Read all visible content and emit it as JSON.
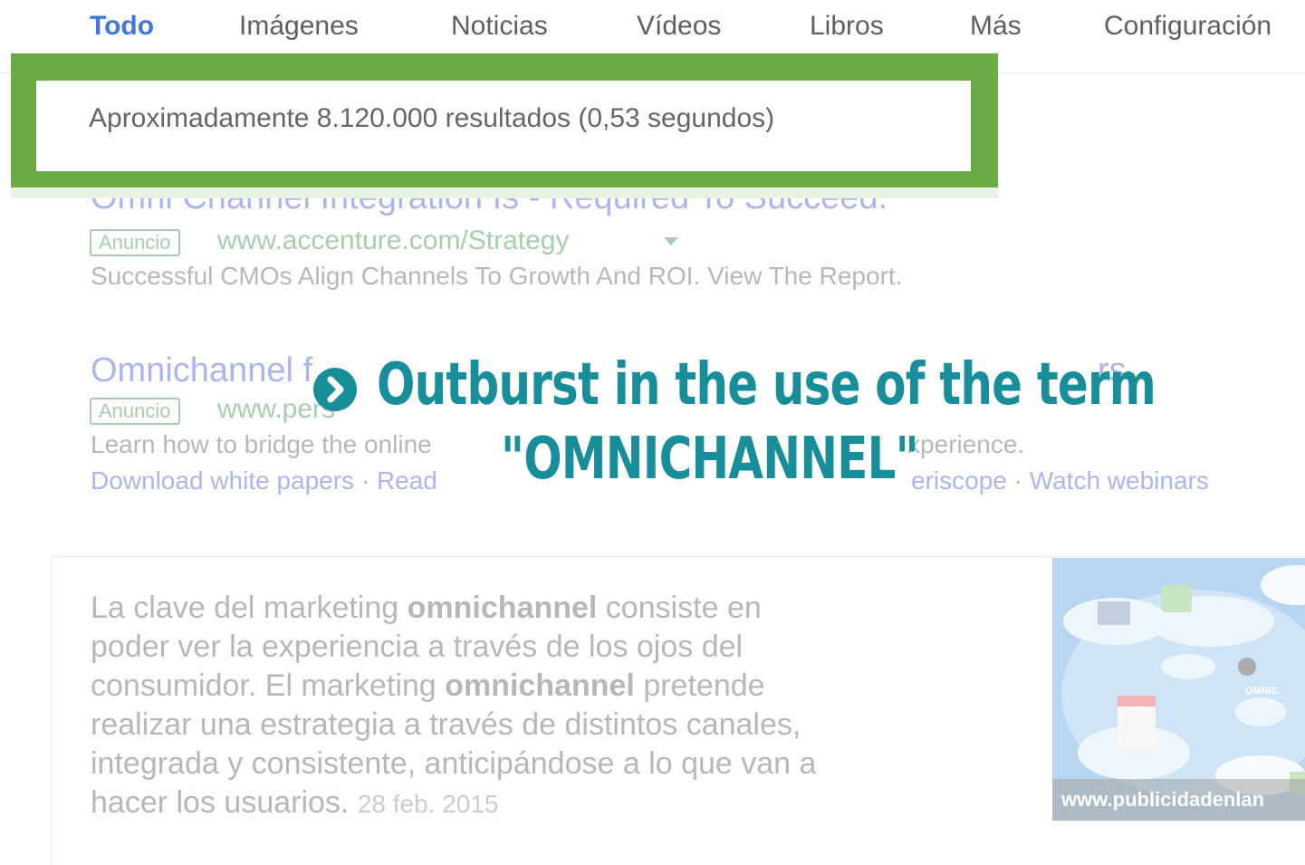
{
  "tabs": [
    "Todo",
    "Imágenes",
    "Noticias",
    "Vídeos",
    "Libros",
    "Más",
    "Configuración"
  ],
  "active_tab": "Todo",
  "result_stats": "Aproximadamente 8.120.000 resultados (0,53 segundos)",
  "ads": [
    {
      "title": "Omni Channel Integration Is - Required To Succeed.",
      "badge": "Anuncio",
      "url": "www.accenture.com/Strategy",
      "description": "Successful CMOs Align Channels To Growth And ROI. View The Report."
    },
    {
      "title_start": "Omnichannel f",
      "title_end": "rs",
      "badge": "Anuncio",
      "url": "www.pers",
      "description_start": "Learn how to bridge the online",
      "description_end": "xperience.",
      "links_start": "Download white papers · Read",
      "links_end": "eriscope · Watch webinars"
    }
  ],
  "snippet": {
    "lines": [
      [
        "La clave del marketing ",
        "omnichannel",
        " consiste en"
      ],
      [
        "poder ver la experiencia a través de los ojos del"
      ],
      [
        "consumidor. El marketing ",
        "omnichannel",
        " pretende"
      ],
      [
        "realizar una estrategia a través de distintos canales,"
      ],
      [
        "integrada y consistente, anticipándose a lo que van a"
      ],
      [
        "hacer los usuarios. "
      ]
    ],
    "date": "28 feb. 2015",
    "image_caption": "www.publicidadenlan",
    "image_labels": [
      "OMNIC"
    ]
  },
  "overlay": {
    "line1": "Outburst in the use of the term",
    "line2": "\"OMNICHANNEL\"",
    "icon": "chevron-right-circle-icon"
  },
  "colors": {
    "highlight_green": "#6aab46",
    "overlay_teal": "#178e9a",
    "active_tab_blue": "#3f78d6"
  }
}
